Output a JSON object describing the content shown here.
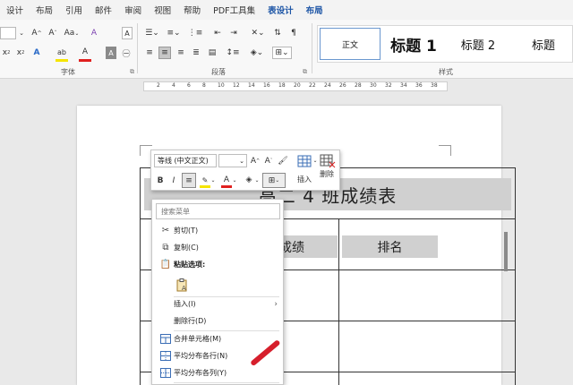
{
  "menu": {
    "tabs": [
      "设计",
      "布局",
      "引用",
      "邮件",
      "审阅",
      "视图",
      "帮助",
      "PDF工具集",
      "表设计",
      "布局"
    ]
  },
  "ribbon": {
    "font_group_label": "字体",
    "paragraph_group_label": "段落",
    "styles_group_label": "样式",
    "font_size_value": "",
    "grow_font": "A",
    "shrink_font": "A",
    "change_case": "Aa",
    "clear_format": "A",
    "char_border": "A",
    "subscript": "x",
    "superscript": "x",
    "text_effect": "A",
    "highlight_letter": "ab",
    "font_color_letter": "A",
    "char_shading": "A",
    "para_marks": "¶",
    "styles": [
      "正文",
      "标题 1",
      "标题 2",
      "标题"
    ]
  },
  "ruler": {
    "ticks": [
      "2",
      "4",
      "6",
      "8",
      "10",
      "12",
      "14",
      "16",
      "18",
      "20",
      "22",
      "24",
      "26",
      "28",
      "30",
      "32",
      "34",
      "36",
      "38"
    ]
  },
  "document": {
    "table_title": "高二 4 班成绩表",
    "header_cells": [
      "成绩",
      "排名"
    ]
  },
  "mini_toolbar": {
    "font_name": "等线 (中文正文)",
    "font_size": "",
    "grow": "A",
    "shrink": "A",
    "bold": "B",
    "italic": "I",
    "insert_label": "插入",
    "delete_label": "删除"
  },
  "context_menu": {
    "search_placeholder": "搜索菜单",
    "items": [
      {
        "label": "剪切(T)",
        "icon": "scissors-icon"
      },
      {
        "label": "复制(C)",
        "icon": "copy-icon"
      },
      {
        "label": "粘贴选项:",
        "icon": "paste-icon"
      },
      {
        "label": "",
        "icon": "paste-keep-text-icon"
      },
      {
        "label": "插入(I)",
        "icon": ""
      },
      {
        "label": "删除行(D)",
        "icon": ""
      },
      {
        "label": "合并单元格(M)",
        "icon": "merge-cells-icon"
      },
      {
        "label": "平均分布各行(N)",
        "icon": "distribute-rows-icon"
      },
      {
        "label": "平均分布各列(Y)",
        "icon": "distribute-columns-icon"
      }
    ]
  },
  "colors": {
    "accent_tab": "#1e56a6",
    "font_color_bar": "#e0201f",
    "highlight_bar": "#f5e500",
    "table_fill": "#d0d0d0",
    "pen": "#d61f2c"
  }
}
